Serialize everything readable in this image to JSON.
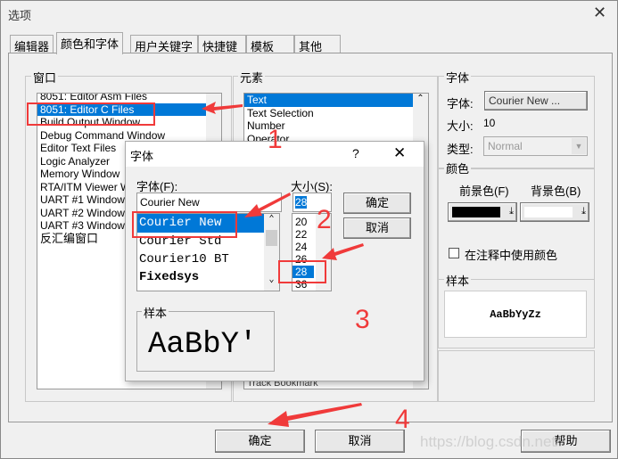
{
  "window": {
    "title": "选项",
    "close_icon": "close-icon"
  },
  "tabs": [
    {
      "label": "编辑器"
    },
    {
      "label": "颜色和字体",
      "selected": true
    },
    {
      "label": "用户关键字"
    },
    {
      "label": "快捷键"
    },
    {
      "label": "模板"
    },
    {
      "label": "其他"
    }
  ],
  "window_group": {
    "label": "窗口",
    "items": [
      "8051: Editor Asm Files",
      "8051: Editor C Files",
      "Build Output Window",
      "Debug Command Window",
      "Editor Text Files",
      "Logic Analyzer",
      "Memory Window",
      "RTA/ITM Viewer Window",
      "UART #1 Window",
      "UART #2 Window",
      "UART #3 Window",
      "反汇编窗口"
    ],
    "selected": "8051: Editor C Files"
  },
  "element_group": {
    "label": "元素",
    "items": [
      "Text",
      "Text Selection",
      "Number",
      "Operator"
    ],
    "selected": "Text",
    "bottom_partial": "Track Bookmark"
  },
  "font_group": {
    "label": "字体",
    "font_label": "字体:",
    "font_button": "Courier New ...",
    "size_label": "大小:",
    "size_value": "10",
    "type_label": "类型:",
    "type_value": "Normal"
  },
  "color_group": {
    "label": "颜色",
    "fg_label": "前景色(F)",
    "bg_label": "背景色(B)",
    "fg_color": "#000000",
    "bg_color": "#ffffff",
    "use_in_comments": "在注释中使用颜色",
    "use_in_comments_checked": false
  },
  "sample_group": {
    "label": "样本",
    "text": "AaBbYyZz"
  },
  "buttons": {
    "ok": "确定",
    "cancel": "取消",
    "help": "帮助"
  },
  "font_dialog": {
    "title": "字体",
    "help": "?",
    "font_label": "字体(F):",
    "font_value": "Courier New",
    "fonts": [
      "Courier New",
      "Courier Std",
      "Courier10 BT",
      "Fixedsys"
    ],
    "size_label": "大小(S):",
    "size_value": "28",
    "sizes": [
      "20",
      "22",
      "24",
      "26",
      "28",
      "36"
    ],
    "ok": "确定",
    "cancel": "取消",
    "sample_label": "样本",
    "sample_text": "AaBbY'"
  },
  "annotations": {
    "steps": [
      "1",
      "2",
      "3",
      "4"
    ],
    "color": "#f03a3a"
  },
  "watermark": "https://blog.csdn.net/"
}
